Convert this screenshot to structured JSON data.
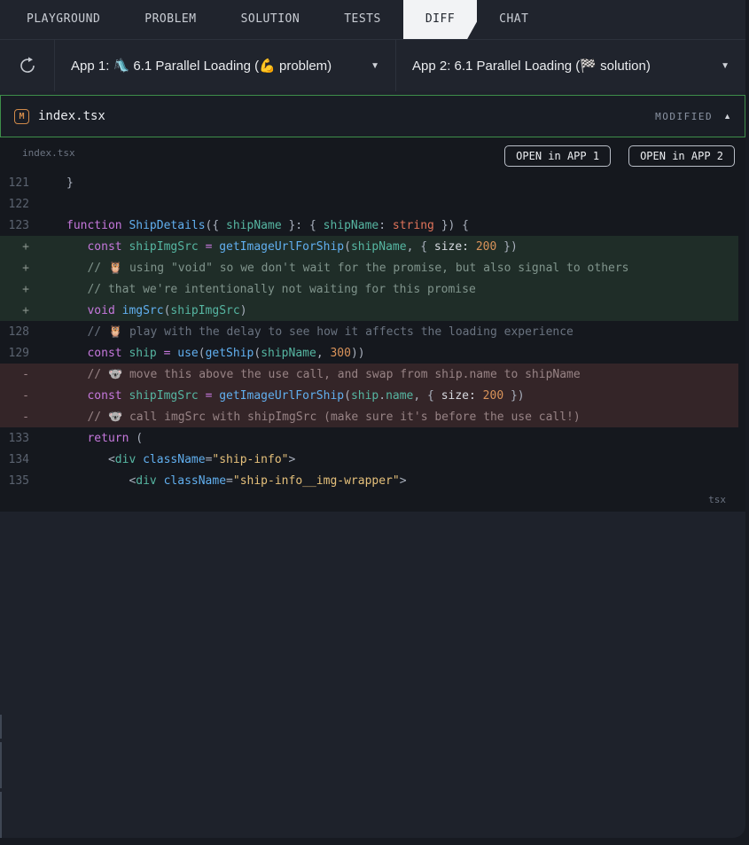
{
  "colors": {
    "accent-green": "#3e8e4a",
    "badge-orange": "#d08a4a",
    "add-bg": "#1f2d28",
    "del-bg": "#342528",
    "kw": "#c678dd",
    "fn": "#61afef",
    "vr": "#56b6a2",
    "num": "#d9935a",
    "typ": "#e0735a",
    "str": "#e5c07b",
    "punct": "#a9b0bd",
    "cmt": "#6a7380",
    "cmt-add": "#80948c",
    "cmt-del": "#978385",
    "plain": "#d7dae0",
    "tag": "#56b6a2",
    "attr": "#61afef",
    "op": "#c678dd"
  },
  "tabs": [
    {
      "label": "PLAYGROUND",
      "active": false
    },
    {
      "label": "PROBLEM",
      "active": false
    },
    {
      "label": "SOLUTION",
      "active": false
    },
    {
      "label": "TESTS",
      "active": false
    },
    {
      "label": "DIFF",
      "active": true
    },
    {
      "label": "CHAT",
      "active": false
    }
  ],
  "toolbar": {
    "refresh_icon": "refresh",
    "app1_label": "App 1: 🛝 6.1 Parallel Loading (💪 problem)",
    "app2_label": "App 2: 6.1 Parallel Loading (🏁 solution)",
    "caret": "▼"
  },
  "file_header": {
    "badge_letter": "M",
    "filename": "index.tsx",
    "status": "MODIFIED",
    "collapse_icon": "▲"
  },
  "diff": {
    "filename_label": "index.tsx",
    "open_app1_label": "OPEN in APP 1",
    "open_app2_label": "OPEN in APP 2",
    "language_label": "tsx",
    "lines": [
      {
        "gutter": "121",
        "kind": "ctx",
        "segments": [
          [
            "punct",
            "}"
          ]
        ]
      },
      {
        "gutter": "122",
        "kind": "ctx",
        "segments": []
      },
      {
        "gutter": "123",
        "kind": "ctx",
        "segments": [
          [
            "kw",
            "function"
          ],
          [
            "plain",
            " "
          ],
          [
            "fn",
            "ShipDetails"
          ],
          [
            "punct",
            "({ "
          ],
          [
            "vr",
            "shipName"
          ],
          [
            "punct",
            " }: { "
          ],
          [
            "vr",
            "shipName"
          ],
          [
            "punct",
            ": "
          ],
          [
            "typ",
            "string"
          ],
          [
            "punct",
            " }) {"
          ]
        ]
      },
      {
        "gutter": "+",
        "kind": "add",
        "segments": [
          [
            "plain",
            "\t"
          ],
          [
            "kw",
            "const"
          ],
          [
            "plain",
            " "
          ],
          [
            "vr",
            "shipImgSrc"
          ],
          [
            "plain",
            " "
          ],
          [
            "op",
            "="
          ],
          [
            "plain",
            " "
          ],
          [
            "fn",
            "getImageUrlForShip"
          ],
          [
            "punct",
            "("
          ],
          [
            "vr",
            "shipName"
          ],
          [
            "punct",
            ", { "
          ],
          [
            "plain",
            "size: "
          ],
          [
            "num",
            "200"
          ],
          [
            "punct",
            " })"
          ]
        ]
      },
      {
        "gutter": "+",
        "kind": "add",
        "segments": [
          [
            "plain",
            "\t"
          ],
          [
            "cmt",
            "// 🦉 using \"void\" so we don't wait for the promise, but also signal to others"
          ]
        ]
      },
      {
        "gutter": "+",
        "kind": "add",
        "segments": [
          [
            "plain",
            "\t"
          ],
          [
            "cmt",
            "// that we're intentionally not waiting for this promise"
          ]
        ]
      },
      {
        "gutter": "+",
        "kind": "add",
        "segments": [
          [
            "plain",
            "\t"
          ],
          [
            "kw",
            "void"
          ],
          [
            "plain",
            " "
          ],
          [
            "fn",
            "imgSrc"
          ],
          [
            "punct",
            "("
          ],
          [
            "vr",
            "shipImgSrc"
          ],
          [
            "punct",
            ")"
          ]
        ]
      },
      {
        "gutter": "128",
        "kind": "ctx",
        "segments": [
          [
            "plain",
            "\t"
          ],
          [
            "cmt",
            "// 🦉 play with the delay to see how it affects the loading experience"
          ]
        ]
      },
      {
        "gutter": "129",
        "kind": "ctx",
        "segments": [
          [
            "plain",
            "\t"
          ],
          [
            "kw",
            "const"
          ],
          [
            "plain",
            " "
          ],
          [
            "vr",
            "ship"
          ],
          [
            "plain",
            " "
          ],
          [
            "op",
            "="
          ],
          [
            "plain",
            " "
          ],
          [
            "fn",
            "use"
          ],
          [
            "punct",
            "("
          ],
          [
            "fn",
            "getShip"
          ],
          [
            "punct",
            "("
          ],
          [
            "vr",
            "shipName"
          ],
          [
            "punct",
            ", "
          ],
          [
            "num",
            "300"
          ],
          [
            "punct",
            "))"
          ]
        ]
      },
      {
        "gutter": "-",
        "kind": "del",
        "segments": [
          [
            "plain",
            "\t"
          ],
          [
            "cmt",
            "// 🐨 move this above the use call, and swap from ship.name to shipName"
          ]
        ]
      },
      {
        "gutter": "-",
        "kind": "del",
        "segments": [
          [
            "plain",
            "\t"
          ],
          [
            "kw",
            "const"
          ],
          [
            "plain",
            " "
          ],
          [
            "vr",
            "shipImgSrc"
          ],
          [
            "plain",
            " "
          ],
          [
            "op",
            "="
          ],
          [
            "plain",
            " "
          ],
          [
            "fn",
            "getImageUrlForShip"
          ],
          [
            "punct",
            "("
          ],
          [
            "vr",
            "ship"
          ],
          [
            "punct",
            "."
          ],
          [
            "vr",
            "name"
          ],
          [
            "punct",
            ", { "
          ],
          [
            "plain",
            "size: "
          ],
          [
            "num",
            "200"
          ],
          [
            "punct",
            " })"
          ]
        ]
      },
      {
        "gutter": "-",
        "kind": "del",
        "segments": [
          [
            "plain",
            "\t"
          ],
          [
            "cmt",
            "// 🐨 call imgSrc with shipImgSrc (make sure it's before the use call!)"
          ]
        ]
      },
      {
        "gutter": "133",
        "kind": "ctx",
        "segments": [
          [
            "plain",
            "\t"
          ],
          [
            "kw",
            "return"
          ],
          [
            "punct",
            " ("
          ]
        ]
      },
      {
        "gutter": "134",
        "kind": "ctx",
        "segments": [
          [
            "plain",
            "\t\t"
          ],
          [
            "punct",
            "<"
          ],
          [
            "tag",
            "div"
          ],
          [
            "plain",
            " "
          ],
          [
            "attr",
            "className"
          ],
          [
            "punct",
            "="
          ],
          [
            "str",
            "\"ship-info\""
          ],
          [
            "punct",
            ">"
          ]
        ]
      },
      {
        "gutter": "135",
        "kind": "ctx",
        "segments": [
          [
            "plain",
            "\t\t\t"
          ],
          [
            "punct",
            "<"
          ],
          [
            "tag",
            "div"
          ],
          [
            "plain",
            " "
          ],
          [
            "attr",
            "className"
          ],
          [
            "punct",
            "="
          ],
          [
            "str",
            "\"ship-info__img-wrapper\""
          ],
          [
            "punct",
            ">"
          ]
        ]
      }
    ]
  }
}
